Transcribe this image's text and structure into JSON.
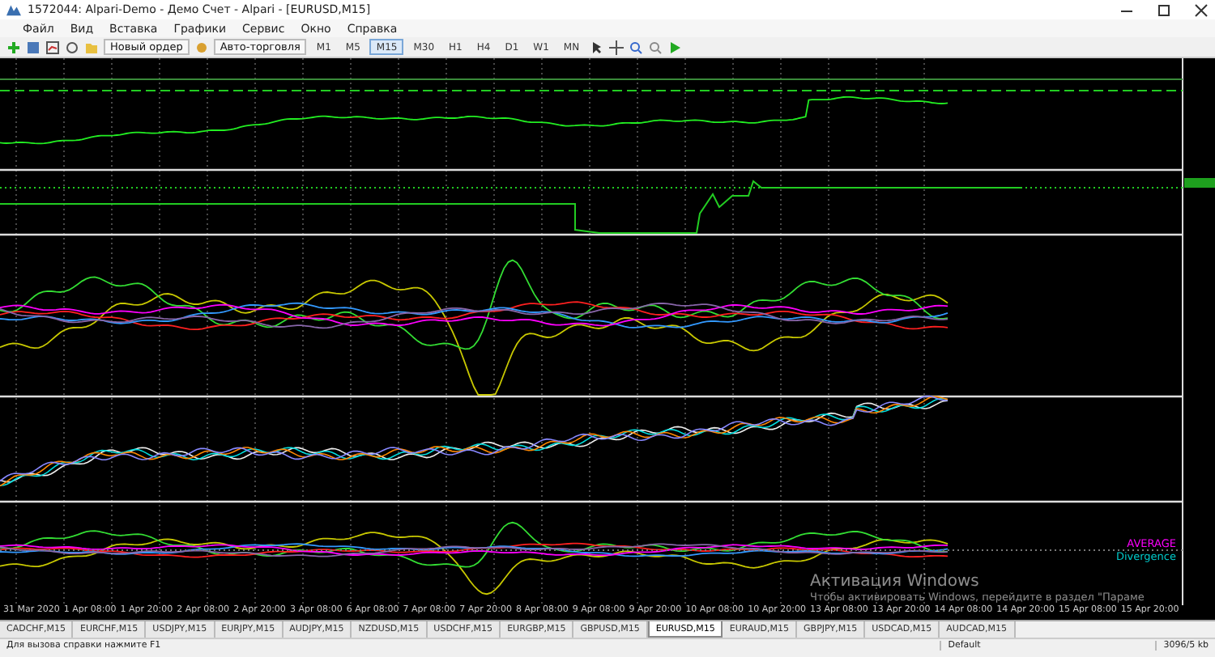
{
  "window": {
    "title": "1572044: Alpari-Demo - Демо Счет - Alpari - [EURUSD,M15]"
  },
  "menu": [
    "Файл",
    "Вид",
    "Вставка",
    "Графики",
    "Сервис",
    "Окно",
    "Справка"
  ],
  "toolbar": {
    "new_order": "Новый ордер",
    "autotrading": "Авто-торговля",
    "timeframes": [
      {
        "label": "M1",
        "selected": false
      },
      {
        "label": "M5",
        "selected": false
      },
      {
        "label": "M15",
        "selected": true
      },
      {
        "label": "M30",
        "selected": false
      },
      {
        "label": "H1",
        "selected": false
      },
      {
        "label": "H4",
        "selected": false
      },
      {
        "label": "D1",
        "selected": false
      },
      {
        "label": "W1",
        "selected": false
      },
      {
        "label": "MN",
        "selected": false
      }
    ]
  },
  "chart": {
    "legend": [
      {
        "text": "AVERAGE",
        "color": "#ff00ff"
      },
      {
        "text": "Divergence",
        "color": "#00c8c8"
      }
    ],
    "time_labels": [
      "31 Mar 2020",
      "1 Apr 08:00",
      "1 Apr 20:00",
      "2 Apr 08:00",
      "2 Apr 20:00",
      "3 Apr 08:00",
      "6 Apr 08:00",
      "7 Apr 08:00",
      "7 Apr 20:00",
      "8 Apr 08:00",
      "9 Apr 08:00",
      "9 Apr 20:00",
      "10 Apr 08:00",
      "10 Apr 20:00",
      "13 Apr 08:00",
      "13 Apr 20:00",
      "14 Apr 08:00",
      "14 Apr 20:00",
      "15 Apr 08:00",
      "15 Apr 20:00"
    ]
  },
  "os_notice": {
    "title": "Активация Windows",
    "text": "Чтобы активировать Windows, перейдите в раздел \"Параме"
  },
  "tabs": [
    {
      "label": "CADCHF,M15",
      "selected": false
    },
    {
      "label": "EURCHF,M15",
      "selected": false
    },
    {
      "label": "USDJPY,M15",
      "selected": false
    },
    {
      "label": "EURJPY,M15",
      "selected": false
    },
    {
      "label": "AUDJPY,M15",
      "selected": false
    },
    {
      "label": "NZDUSD,M15",
      "selected": false
    },
    {
      "label": "USDCHF,M15",
      "selected": false
    },
    {
      "label": "EURGBP,M15",
      "selected": false
    },
    {
      "label": "GBPUSD,M15",
      "selected": false
    },
    {
      "label": "EURUSD,M15",
      "selected": true
    },
    {
      "label": "EURAUD,M15",
      "selected": false
    },
    {
      "label": "GBPJPY,M15",
      "selected": false
    },
    {
      "label": "USDCAD,M15",
      "selected": false
    },
    {
      "label": "AUDCAD,M15",
      "selected": false
    }
  ],
  "status_bar": {
    "help": "Для вызова справки нажмите F1",
    "profile": "Default",
    "traffic": "3096/5 kb"
  }
}
